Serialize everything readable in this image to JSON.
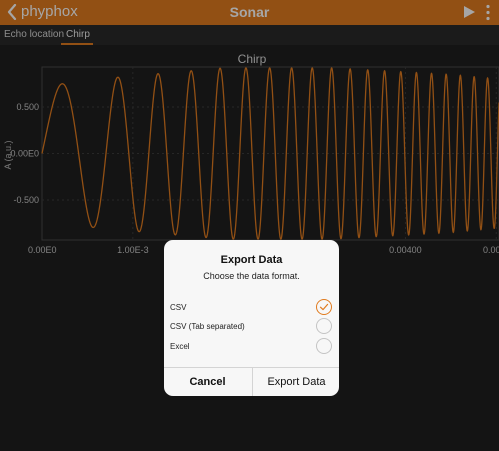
{
  "app": {
    "brand": "phyphox",
    "title": "Sonar",
    "accent": "#e07b1f"
  },
  "tabs": [
    {
      "label": "Echo location",
      "active": false
    },
    {
      "label": "Chirp",
      "active": true
    }
  ],
  "chart_data": {
    "type": "line",
    "title": "Chirp",
    "xlabel": "",
    "ylabel": "A (a.u.)",
    "xlim": [
      0,
      0.00503
    ],
    "ylim": [
      -0.93,
      0.93
    ],
    "grid": true,
    "series_color": "#e07b1f",
    "x_tick_labels": [
      "0.00E0",
      "1.00E-3",
      "0.00400",
      "0.00"
    ],
    "x_tick_values": [
      0,
      0.001,
      0.004,
      0.005
    ],
    "y_tick_labels": [
      "0.500",
      "0.00E0",
      "-0.500"
    ],
    "y_tick_values": [
      0.5,
      0,
      -0.5
    ],
    "signal": {
      "description": "linear chirp",
      "amplitude_points": [
        [
          0,
          0.72
        ],
        [
          0.0006,
          0.8
        ],
        [
          0.002,
          0.92
        ],
        [
          0.0032,
          0.92
        ],
        [
          0.0045,
          0.85
        ],
        [
          0.00503,
          0.8
        ]
      ],
      "start_frequency_hz": 1000,
      "end_frequency_hz": 7000
    }
  },
  "dialog": {
    "title": "Export Data",
    "subtitle": "Choose the data format.",
    "options": [
      {
        "label": "CSV",
        "selected": true
      },
      {
        "label": "CSV (Tab separated)",
        "selected": false
      },
      {
        "label": "Excel",
        "selected": false
      }
    ],
    "cancel_label": "Cancel",
    "export_label": "Export Data"
  }
}
